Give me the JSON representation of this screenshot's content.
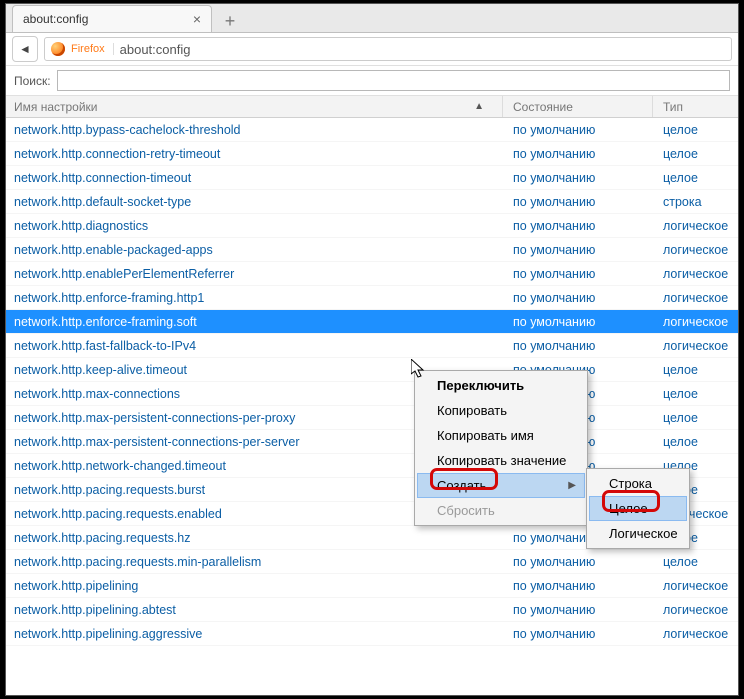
{
  "tab": {
    "title": "about:config"
  },
  "address": {
    "brand": "Firefox",
    "url": "about:config"
  },
  "search": {
    "label": "Поиск:"
  },
  "columns": {
    "name": "Имя настройки",
    "state": "Состояние",
    "type": "Тип"
  },
  "state_default": "по умолчанию",
  "types": {
    "int": "целое",
    "string": "строка",
    "bool": "логическое"
  },
  "rows": [
    {
      "name": "network.http.bypass-cachelock-threshold",
      "type": "int"
    },
    {
      "name": "network.http.connection-retry-timeout",
      "type": "int"
    },
    {
      "name": "network.http.connection-timeout",
      "type": "int"
    },
    {
      "name": "network.http.default-socket-type",
      "type": "string"
    },
    {
      "name": "network.http.diagnostics",
      "type": "bool"
    },
    {
      "name": "network.http.enable-packaged-apps",
      "type": "bool"
    },
    {
      "name": "network.http.enablePerElementReferrer",
      "type": "bool"
    },
    {
      "name": "network.http.enforce-framing.http1",
      "type": "bool"
    },
    {
      "name": "network.http.enforce-framing.soft",
      "type": "bool",
      "selected": true
    },
    {
      "name": "network.http.fast-fallback-to-IPv4",
      "type": "bool"
    },
    {
      "name": "network.http.keep-alive.timeout",
      "type": "int"
    },
    {
      "name": "network.http.max-connections",
      "type": "int"
    },
    {
      "name": "network.http.max-persistent-connections-per-proxy",
      "type": "int"
    },
    {
      "name": "network.http.max-persistent-connections-per-server",
      "type": "int"
    },
    {
      "name": "network.http.network-changed.timeout",
      "type": "int"
    },
    {
      "name": "network.http.pacing.requests.burst",
      "type": "int"
    },
    {
      "name": "network.http.pacing.requests.enabled",
      "type": "bool"
    },
    {
      "name": "network.http.pacing.requests.hz",
      "type": "int"
    },
    {
      "name": "network.http.pacing.requests.min-parallelism",
      "type": "int"
    },
    {
      "name": "network.http.pipelining",
      "type": "bool"
    },
    {
      "name": "network.http.pipelining.abtest",
      "type": "bool"
    },
    {
      "name": "network.http.pipelining.aggressive",
      "type": "bool"
    }
  ],
  "contextmenu": {
    "toggle": "Переключить",
    "copy": "Копировать",
    "copy_name": "Копировать имя",
    "copy_value": "Копировать значение",
    "create": "Создать",
    "reset": "Сбросить"
  },
  "submenu": {
    "string": "Строка",
    "integer": "Целое",
    "boolean": "Логическое"
  }
}
